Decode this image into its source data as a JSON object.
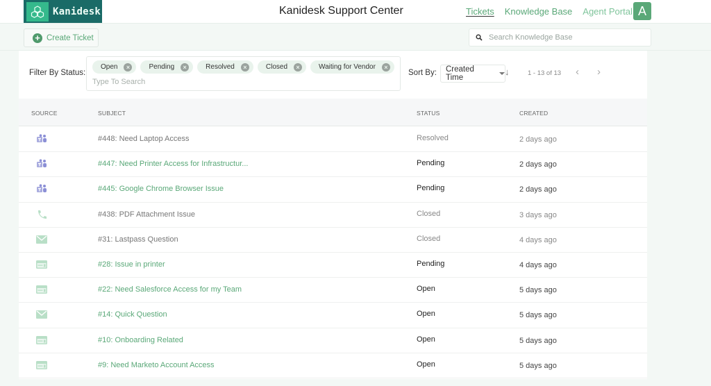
{
  "header": {
    "logo_text": "Kanidesk",
    "title": "Kanidesk Support Center",
    "nav": [
      {
        "label": "Tickets",
        "active": true
      },
      {
        "label": "Knowledge Base",
        "active": false
      },
      {
        "label": "Agent Portal",
        "active": false
      }
    ],
    "avatar_initial": "A"
  },
  "toolbar": {
    "create_ticket_label": "Create Ticket",
    "kb_search_placeholder": "Search Knowledge Base"
  },
  "filters": {
    "label": "Filter By Status:",
    "chips": [
      "Open",
      "Pending",
      "Resolved",
      "Closed",
      "Waiting for Vendor"
    ],
    "search_placeholder": "Type To Search"
  },
  "sort": {
    "label": "Sort By:",
    "selected": "Created Time",
    "direction_icon": "arrow-down-icon"
  },
  "pagination": {
    "info": "1 - 13 of 13",
    "prev": "‹",
    "next": "›"
  },
  "table": {
    "columns": [
      "SOURCE",
      "SUBJECT",
      "STATUS",
      "CREATED"
    ],
    "rows": [
      {
        "source": "teams",
        "subject": "#448: Need Laptop Access",
        "status": "Resolved",
        "created": "2 days ago",
        "closed": true
      },
      {
        "source": "teams",
        "subject": "#447: Need Printer Access for Infrastructur...",
        "status": "Pending",
        "created": "2 days ago",
        "closed": false
      },
      {
        "source": "teams",
        "subject": "#445: Google Chrome Browser Issue",
        "status": "Pending",
        "created": "2 days ago",
        "closed": false
      },
      {
        "source": "phone",
        "subject": "#438: PDF Attachment Issue",
        "status": "Closed",
        "created": "3 days ago",
        "closed": true
      },
      {
        "source": "email",
        "subject": "#31: Lastpass Question",
        "status": "Closed",
        "created": "4 days ago",
        "closed": true
      },
      {
        "source": "web-form",
        "subject": "#28: Issue in printer",
        "status": "Pending",
        "created": "4 days ago",
        "closed": false
      },
      {
        "source": "web-form",
        "subject": "#22: Need Salesforce Access for my Team",
        "status": "Open",
        "created": "5 days ago",
        "closed": false
      },
      {
        "source": "email",
        "subject": "#14: Quick Question",
        "status": "Open",
        "created": "5 days ago",
        "closed": false
      },
      {
        "source": "web-form",
        "subject": "#10: Onboarding Related",
        "status": "Open",
        "created": "5 days ago",
        "closed": false
      },
      {
        "source": "web-form",
        "subject": "#9: Need Marketo Account Access",
        "status": "Open",
        "created": "5 days ago",
        "closed": false
      }
    ]
  },
  "colors": {
    "brand_dark": "#1a6b67",
    "brand_light": "#35b98c",
    "accent": "#5aa878",
    "teams_icon": "#8b8fd6",
    "source_icon": "#b9dfc7"
  }
}
